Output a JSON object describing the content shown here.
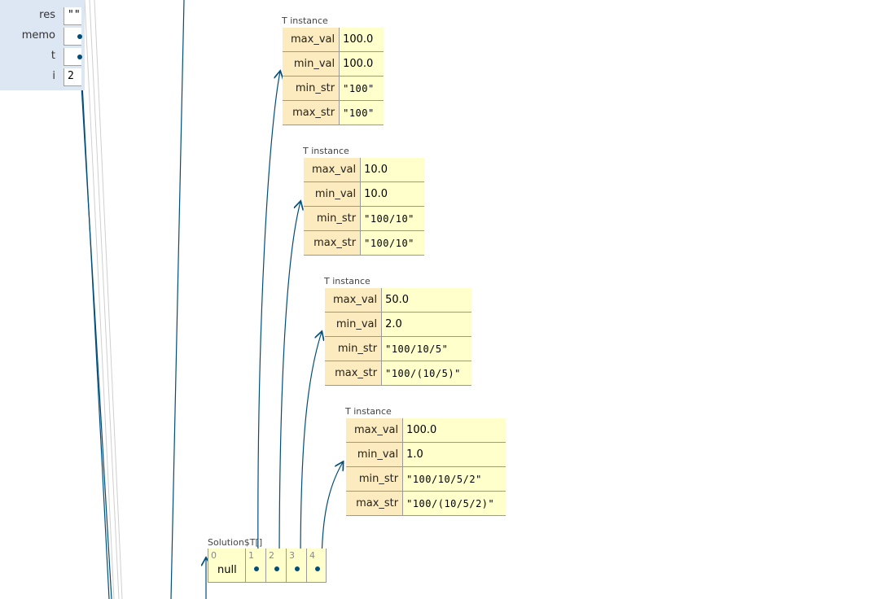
{
  "frame": {
    "vars": [
      {
        "name": "res",
        "value": "\"\""
      },
      {
        "name": "memo",
        "value": ""
      },
      {
        "name": "t",
        "value": ""
      },
      {
        "name": "i",
        "value": "2"
      }
    ]
  },
  "objects": [
    {
      "label": "T instance",
      "fields": [
        {
          "name": "max_val",
          "value": "100.0"
        },
        {
          "name": "min_val",
          "value": "100.0"
        },
        {
          "name": "min_str",
          "value": "\"100\""
        },
        {
          "name": "max_str",
          "value": "\"100\""
        }
      ]
    },
    {
      "label": "T instance",
      "fields": [
        {
          "name": "max_val",
          "value": "10.0"
        },
        {
          "name": "min_val",
          "value": "10.0"
        },
        {
          "name": "min_str",
          "value": "\"100/10\""
        },
        {
          "name": "max_str",
          "value": "\"100/10\""
        }
      ]
    },
    {
      "label": "T instance",
      "fields": [
        {
          "name": "max_val",
          "value": "50.0"
        },
        {
          "name": "min_val",
          "value": "2.0"
        },
        {
          "name": "min_str",
          "value": "\"100/10/5\""
        },
        {
          "name": "max_str",
          "value": "\"100/(10/5)\""
        }
      ]
    },
    {
      "label": "T instance",
      "fields": [
        {
          "name": "max_val",
          "value": "100.0"
        },
        {
          "name": "min_val",
          "value": "1.0"
        },
        {
          "name": "min_str",
          "value": "\"100/10/5/2\""
        },
        {
          "name": "max_str",
          "value": "\"100/(10/5/2)\""
        }
      ]
    }
  ],
  "array": {
    "label": "Solution$T[]",
    "cells": [
      {
        "index": "0",
        "value": "null"
      },
      {
        "index": "1"
      },
      {
        "index": "2"
      },
      {
        "index": "3"
      },
      {
        "index": "4"
      }
    ]
  },
  "colors": {
    "pointer": "#004d7a",
    "field_name_bg": "#fcebbf",
    "field_value_bg": "#ffffcc",
    "frame_bg": "#dde6f3"
  }
}
